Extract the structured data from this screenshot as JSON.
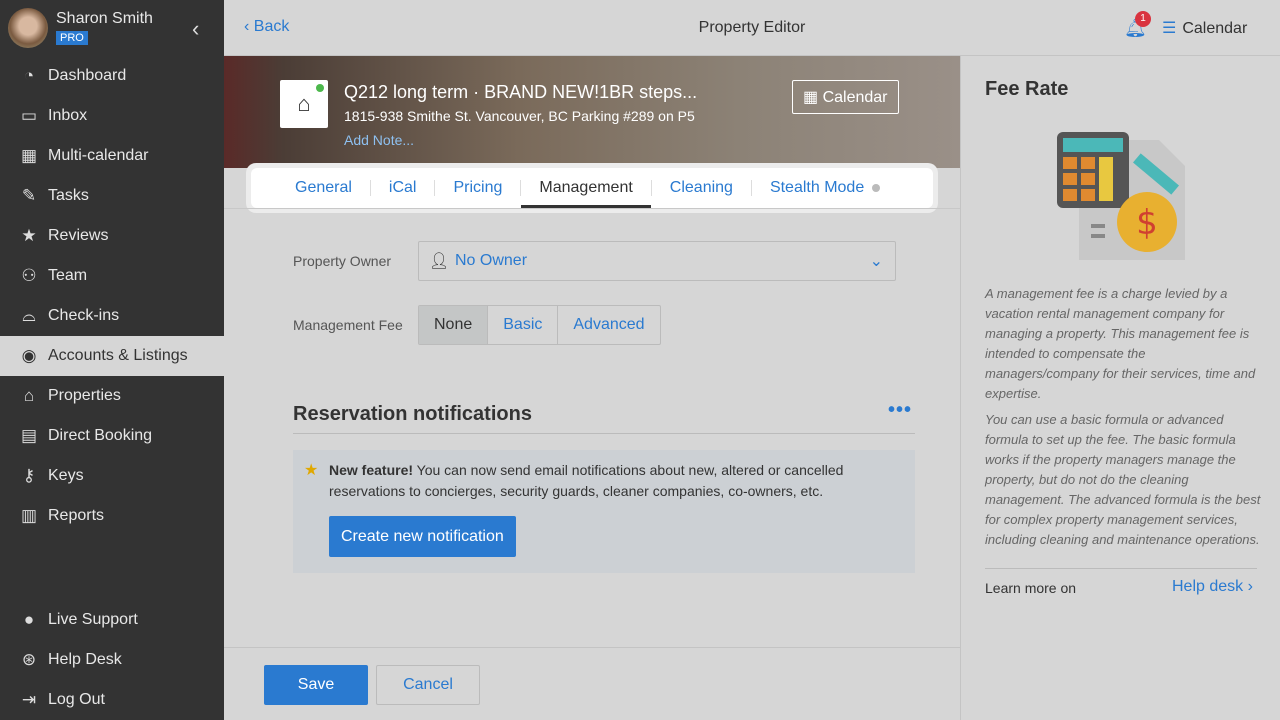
{
  "user": {
    "name": "Sharon Smith",
    "plan": "PRO"
  },
  "sidebar": {
    "items": [
      {
        "label": "Dashboard",
        "icon": "gauge-icon"
      },
      {
        "label": "Inbox",
        "icon": "inbox-icon"
      },
      {
        "label": "Multi-calendar",
        "icon": "calendar-icon"
      },
      {
        "label": "Tasks",
        "icon": "tasks-icon"
      },
      {
        "label": "Reviews",
        "icon": "star-icon"
      },
      {
        "label": "Team",
        "icon": "team-icon"
      },
      {
        "label": "Check-ins",
        "icon": "bell-icon"
      },
      {
        "label": "Accounts & Listings",
        "icon": "user-circle-icon",
        "active": true
      },
      {
        "label": "Properties",
        "icon": "home-icon"
      },
      {
        "label": "Direct Booking",
        "icon": "browser-code-icon"
      },
      {
        "label": "Keys",
        "icon": "key-icon"
      },
      {
        "label": "Reports",
        "icon": "chart-icon"
      }
    ],
    "bottom": [
      {
        "label": "Live Support",
        "icon": "chat-icon"
      },
      {
        "label": "Help Desk",
        "icon": "lifebuoy-icon"
      },
      {
        "label": "Log Out",
        "icon": "logout-icon"
      }
    ]
  },
  "header": {
    "back": "Back",
    "title": "Property Editor",
    "notifications": "1",
    "calendar": "Calendar"
  },
  "property": {
    "title": "Q212 long term · BRAND NEW!1BR steps...",
    "address": "1815-938 Smithe St. Vancouver, BC Parking #289 on P5",
    "note": "Add Note...",
    "calendar": "Calendar"
  },
  "tabs": [
    "General",
    "iCal",
    "Pricing",
    "Management",
    "Cleaning",
    "Stealth Mode"
  ],
  "form": {
    "owner_label": "Property Owner",
    "owner_value": "No Owner",
    "fee_label": "Management Fee",
    "fee_options": [
      "None",
      "Basic",
      "Advanced"
    ],
    "fee_selected": "None"
  },
  "notifications": {
    "title": "Reservation notifications",
    "bold": "New feature!",
    "text": " You can now send email notifications about new, altered or cancelled reservations to concierges, security guards, cleaner companies, co-owners, etc.",
    "button": "Create new notification"
  },
  "footer": {
    "save": "Save",
    "cancel": "Cancel"
  },
  "panel": {
    "title": "Fee Rate",
    "p1": "A management fee is a charge levied by a vacation rental management company for managing a property. This management fee is intended to compensate the managers/company for their services, time and expertise.",
    "p2": "You can use a basic formula or advanced formula to set up the fee. The basic formula works if the property managers manage the property, but do not do the cleaning management. The advanced formula is the best for complex property management services, including cleaning and maintenance operations.",
    "learn": "Learn more on",
    "helpdesk": "Help desk"
  }
}
